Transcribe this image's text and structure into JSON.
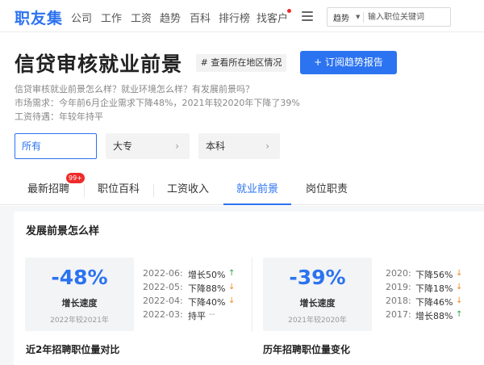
{
  "nav": {
    "logo": "职友集",
    "items": [
      "公司",
      "工作",
      "工资",
      "趋势",
      "百科",
      "排行榜",
      "找客户"
    ],
    "search": {
      "type_label": "趋势",
      "placeholder": "输入职位关键词"
    }
  },
  "header": {
    "title": "信贷审核就业前景",
    "region_tag": "# 查看所在地区情况",
    "subscribe_label": "+ 订阅趋势报告",
    "desc": [
      "信贷审核就业前景怎么样？就业环境怎么样？有发展前景吗？",
      "市场需求：今年前6月企业需求下降48%，2021年较2020年下降了39%",
      "工资待遇：年较年持平"
    ]
  },
  "filters": [
    {
      "label": "所有",
      "active": true
    },
    {
      "label": "大专",
      "active": false
    },
    {
      "label": "本科",
      "active": false
    }
  ],
  "tabs": {
    "items": [
      "最新招聘",
      "职位百科",
      "工资收入",
      "就业前景",
      "岗位职责"
    ],
    "active_index": 3,
    "badge": "99+"
  },
  "section": {
    "title": "发展前景怎么样",
    "cards": [
      {
        "value": "-48%",
        "label": "增长速度",
        "note": "2022年较2021年",
        "trends": [
          {
            "date": "2022-06:",
            "text": "增长50%",
            "dir": "up"
          },
          {
            "date": "2022-05:",
            "text": "下降88%",
            "dir": "down"
          },
          {
            "date": "2022-04:",
            "text": "下降40%",
            "dir": "down"
          },
          {
            "date": "2022-03:",
            "text": "持平",
            "dir": "flat"
          }
        ]
      },
      {
        "value": "-39%",
        "label": "增长速度",
        "note": "2021年较2020年",
        "trends": [
          {
            "date": "2020:",
            "text": "下降56%",
            "dir": "down"
          },
          {
            "date": "2019:",
            "text": "下降18%",
            "dir": "down"
          },
          {
            "date": "2018:",
            "text": "下降46%",
            "dir": "down"
          },
          {
            "date": "2017:",
            "text": "增长88%",
            "dir": "up"
          }
        ]
      }
    ],
    "sub_titles": [
      "近2年招聘职位量对比",
      "历年招聘职位量变化"
    ]
  },
  "glyphs": {
    "up": "↑",
    "down": "↓",
    "flat": "--",
    "chevron": "›"
  },
  "colors": {
    "brand": "#2b73f0",
    "up": "#27a844",
    "down": "#f08a24",
    "badge": "#f02b2b"
  }
}
